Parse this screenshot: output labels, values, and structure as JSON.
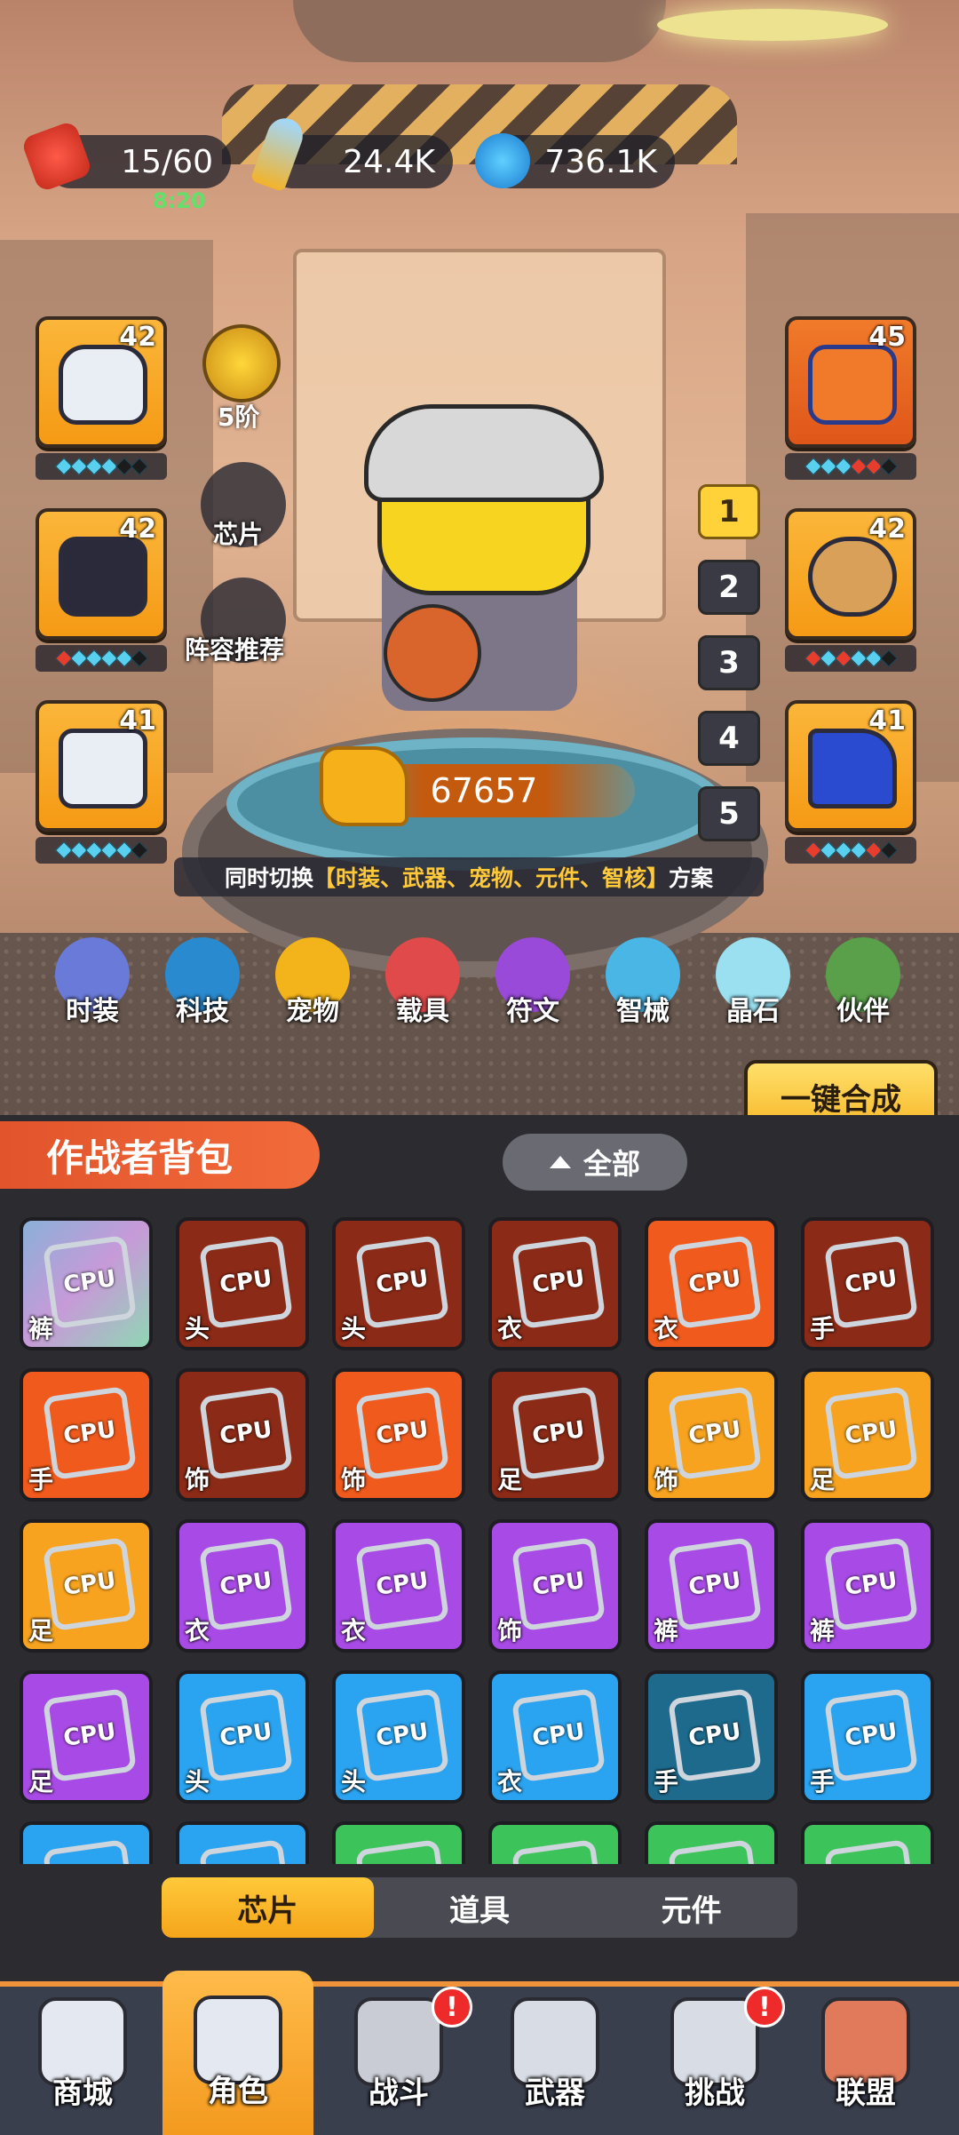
{
  "resources": {
    "energy": "15/60",
    "energy_timer": "8:20",
    "ammo": "24.4K",
    "coins": "736.1K"
  },
  "left_slots": [
    {
      "level": "42",
      "gems": [
        "blue",
        "blue",
        "blue",
        "blue",
        "dark",
        "dark"
      ]
    },
    {
      "level": "42",
      "gems": [
        "red",
        "blue",
        "blue",
        "blue",
        "blue",
        "dark"
      ]
    },
    {
      "level": "41",
      "gems": [
        "blue",
        "blue",
        "blue",
        "blue",
        "blue",
        "dark"
      ]
    }
  ],
  "right_slots": [
    {
      "level": "45",
      "gems": [
        "blue",
        "blue",
        "blue",
        "red",
        "red",
        "dark"
      ]
    },
    {
      "level": "42",
      "gems": [
        "red",
        "blue",
        "red",
        "blue",
        "blue",
        "dark"
      ]
    },
    {
      "level": "41",
      "gems": [
        "red",
        "blue",
        "blue",
        "blue",
        "red",
        "dark"
      ]
    }
  ],
  "medal": {
    "label": "5阶"
  },
  "side_buttons": {
    "chip": "芯片",
    "recommend": "阵容推荐"
  },
  "presets": [
    "1",
    "2",
    "3",
    "4",
    "5"
  ],
  "active_preset": "1",
  "power": "67657",
  "switch_hint": {
    "prefix": "同时切换",
    "highlight": "【时装、武器、宠物、元件、智核】",
    "suffix": "方案"
  },
  "category_tabs": [
    "时装",
    "科技",
    "宠物",
    "载具",
    "符文",
    "智械",
    "晶石",
    "伙伴"
  ],
  "merge_button": "一键合成",
  "bag": {
    "title": "作战者背包",
    "filter": "全部",
    "chip_text": "CPU",
    "items": [
      {
        "part": "裤",
        "rarity": "rainbow"
      },
      {
        "part": "头",
        "rarity": "darkred"
      },
      {
        "part": "头",
        "rarity": "darkred"
      },
      {
        "part": "衣",
        "rarity": "darkred"
      },
      {
        "part": "衣",
        "rarity": "red"
      },
      {
        "part": "手",
        "rarity": "darkred"
      },
      {
        "part": "手",
        "rarity": "red"
      },
      {
        "part": "饰",
        "rarity": "darkred"
      },
      {
        "part": "饰",
        "rarity": "red"
      },
      {
        "part": "足",
        "rarity": "darkred"
      },
      {
        "part": "饰",
        "rarity": "orange"
      },
      {
        "part": "足",
        "rarity": "orange"
      },
      {
        "part": "足",
        "rarity": "orange"
      },
      {
        "part": "衣",
        "rarity": "purple"
      },
      {
        "part": "衣",
        "rarity": "purple"
      },
      {
        "part": "饰",
        "rarity": "purple"
      },
      {
        "part": "裤",
        "rarity": "purple"
      },
      {
        "part": "裤",
        "rarity": "purple"
      },
      {
        "part": "足",
        "rarity": "purple"
      },
      {
        "part": "头",
        "rarity": "blue"
      },
      {
        "part": "头",
        "rarity": "blue"
      },
      {
        "part": "衣",
        "rarity": "blue"
      },
      {
        "part": "手",
        "rarity": "darkblue"
      },
      {
        "part": "手",
        "rarity": "blue"
      },
      {
        "part": "",
        "rarity": "blue"
      },
      {
        "part": "",
        "rarity": "blue"
      },
      {
        "part": "",
        "rarity": "green"
      },
      {
        "part": "",
        "rarity": "green"
      },
      {
        "part": "",
        "rarity": "green"
      },
      {
        "part": "",
        "rarity": "green"
      }
    ]
  },
  "sub_tabs": [
    "芯片",
    "道具",
    "元件"
  ],
  "active_sub_tab": "芯片",
  "nav": [
    {
      "label": "商城",
      "badge": ""
    },
    {
      "label": "角色",
      "badge": ""
    },
    {
      "label": "战斗",
      "badge": "!"
    },
    {
      "label": "武器",
      "badge": ""
    },
    {
      "label": "挑战",
      "badge": "!"
    },
    {
      "label": "联盟",
      "badge": ""
    }
  ],
  "active_nav": "角色"
}
